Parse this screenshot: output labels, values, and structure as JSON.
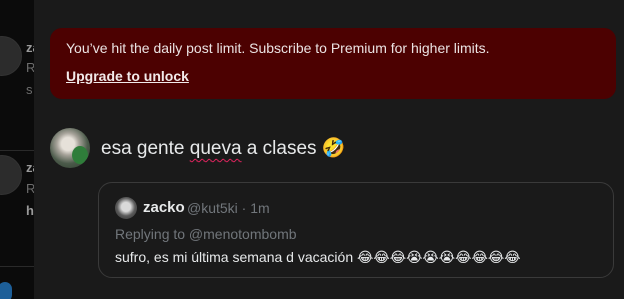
{
  "background": {
    "fragments": [
      "za",
      "R",
      "s",
      "za",
      "R",
      "h"
    ]
  },
  "banner": {
    "message": "You’ve hit the daily post limit. Subscribe to Premium for higher limits.",
    "link_label": "Upgrade to unlock"
  },
  "post": {
    "text_before": "esa gente ",
    "text_misspelled": "queva",
    "text_after": " a clases  ",
    "emoji": "🤣"
  },
  "quoted": {
    "name": "zacko",
    "handle_time": "@kut5ki · 1m",
    "replying_to": "Replying to @menotombomb",
    "body": "sufro, es mi última semana d vacación 😂😂😂😭😭😭😂😂😂😂"
  },
  "colors": {
    "banner_bg": "#4c0101",
    "modal_bg": "#1a1a1a",
    "muted_text": "#71767b"
  }
}
